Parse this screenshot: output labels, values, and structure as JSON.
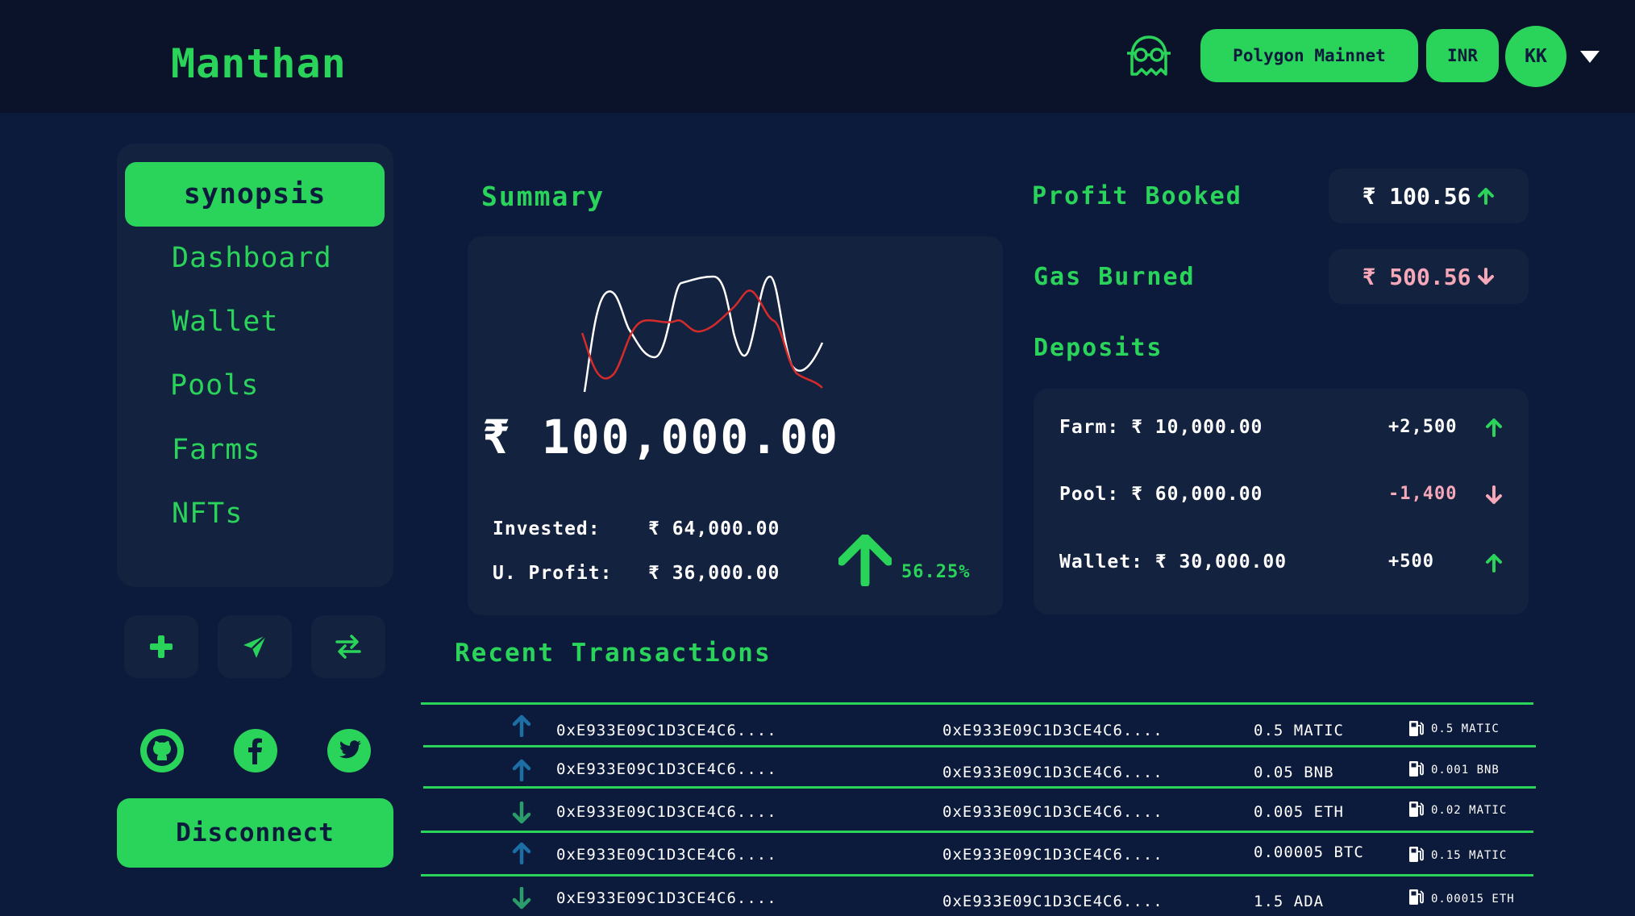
{
  "header": {
    "logo": "Manthan",
    "network": "Polygon Mainnet",
    "currency": "INR",
    "avatar_initials": "KK",
    "ghost_icon": "ghost-icon",
    "dropdown_icon": "caret-down-icon"
  },
  "sidebar": {
    "items": [
      {
        "label": "synopsis",
        "active": true
      },
      {
        "label": "Dashboard",
        "active": false
      },
      {
        "label": "Wallet",
        "active": false
      },
      {
        "label": "Pools",
        "active": false
      },
      {
        "label": "Farms",
        "active": false
      },
      {
        "label": "NFTs",
        "active": false
      }
    ],
    "actions": [
      "plus-icon",
      "send-icon",
      "swap-icon"
    ],
    "socials": [
      "github-icon",
      "facebook-icon",
      "twitter-icon"
    ],
    "disconnect_label": "Disconnect"
  },
  "summary": {
    "title": "Summary",
    "total": "₹ 100,000.00",
    "invested_label": "Invested:",
    "invested_value": "₹ 64,000.00",
    "profit_label": "U. Profit:",
    "profit_value": "₹ 36,000.00",
    "change_pct": "56.25%"
  },
  "metrics": {
    "profit_booked_label": "Profit Booked",
    "profit_booked_value": "₹ 100.56",
    "profit_booked_trend": "up",
    "gas_burned_label": "Gas Burned",
    "gas_burned_value": "₹ 500.56",
    "gas_burned_trend": "down"
  },
  "deposits": {
    "title": "Deposits",
    "rows": [
      {
        "label": "Farm: ₹ 10,000.00",
        "change": "+2,500",
        "trend": "up"
      },
      {
        "label": "Pool: ₹ 60,000.00",
        "change": "-1,400",
        "trend": "down"
      },
      {
        "label": "Wallet: ₹ 30,000.00",
        "change": "+500",
        "trend": "up"
      }
    ]
  },
  "transactions": {
    "title": "Recent Transactions",
    "rows": [
      {
        "direction": "up",
        "from": "0xE933E09C1D3CE4C6....",
        "to": "0xE933E09C1D3CE4C6....",
        "amount": "0.5 MATIC",
        "fee": "0.5 MATIC"
      },
      {
        "direction": "up",
        "from": "0xE933E09C1D3CE4C6....",
        "to": "0xE933E09C1D3CE4C6....",
        "amount": "0.05 BNB",
        "fee": "0.001 BNB"
      },
      {
        "direction": "down",
        "from": "0xE933E09C1D3CE4C6....",
        "to": "0xE933E09C1D3CE4C6....",
        "amount": "0.005 ETH",
        "fee": "0.02 MATIC"
      },
      {
        "direction": "up",
        "from": "0xE933E09C1D3CE4C6....",
        "to": "0xE933E09C1D3CE4C6....",
        "amount": "0.00005 BTC",
        "fee": "0.15 MATIC"
      },
      {
        "direction": "down",
        "from": "0xE933E09C1D3CE4C6....",
        "to": "0xE933E09C1D3CE4C6....",
        "amount": "1.5 ADA",
        "fee": "0.00015 ETH"
      }
    ]
  },
  "colors": {
    "accent": "#2ad35a",
    "background": "#0c1a3b",
    "card": "#13223f",
    "negative": "#f7a8b8",
    "tx_up": "#1c6ea4",
    "tx_down": "#2a9d6a"
  }
}
